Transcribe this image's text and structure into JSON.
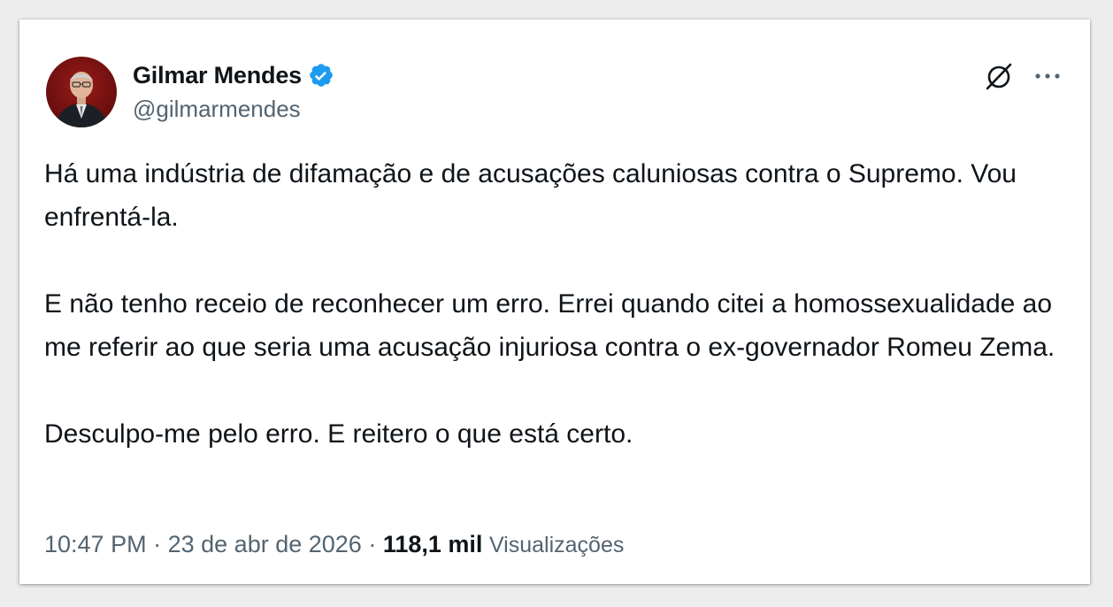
{
  "author": {
    "display_name": "Gilmar Mendes",
    "handle": "@gilmarmendes",
    "verified": true,
    "verified_color": "#1d9bf0"
  },
  "icons": {
    "verified": "verified-badge-icon",
    "grok": "grok-icon",
    "more": "more-options-icon"
  },
  "tweet": {
    "paragraphs": [
      "Há uma indústria de difamação e de acusações caluniosas contra o Supremo. Vou enfrentá-la.",
      "E não tenho receio de reconhecer um erro. Errei quando citei a homossexualidade ao me referir ao que seria uma acusação injuriosa contra o ex-governador Romeu Zema.",
      "Desculpo-me pelo erro. E reitero o que está certo."
    ]
  },
  "meta": {
    "time": "10:47 PM",
    "separator": "·",
    "date": "23 de abr de 2026",
    "views_count": "118,1 mil",
    "views_label": "Visualizações"
  },
  "colors": {
    "text_primary": "#0f1419",
    "text_secondary": "#536471"
  }
}
